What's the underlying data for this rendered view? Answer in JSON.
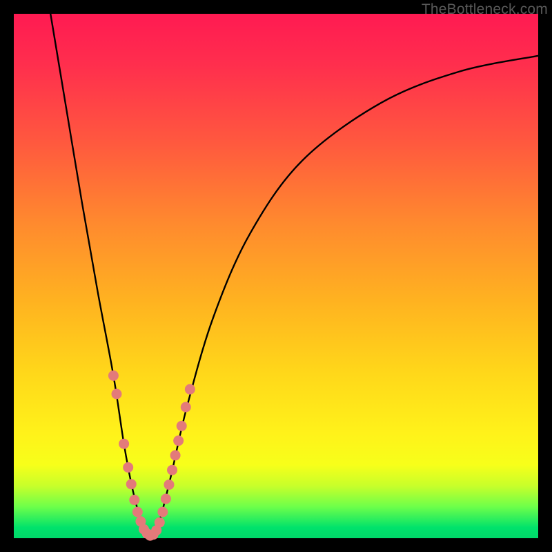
{
  "watermark": "TheBottleneck.com",
  "chart_data": {
    "type": "line",
    "title": "",
    "xlabel": "",
    "ylabel": "",
    "xlim": [
      0,
      100
    ],
    "ylim": [
      0,
      100
    ],
    "series": [
      {
        "name": "bottleneck-curve",
        "x": [
          7,
          10,
          13,
          16,
          19,
          21,
          22.5,
          24,
          25,
          26,
          27,
          28,
          30,
          33,
          38,
          45,
          55,
          70,
          85,
          100
        ],
        "y": [
          100,
          82,
          64,
          47,
          31,
          18,
          10,
          4,
          0.8,
          0.5,
          1.2,
          4,
          12,
          25,
          42,
          58,
          72,
          83,
          89,
          92
        ]
      }
    ],
    "markers": {
      "name": "highlight-points",
      "color": "#e37a7a",
      "x": [
        19.0,
        19.6,
        21.0,
        21.8,
        22.4,
        23.0,
        23.6,
        24.2,
        24.8,
        25.4,
        26.0,
        26.6,
        27.2,
        27.8,
        28.4,
        29.0,
        29.6,
        30.2,
        30.8,
        31.4,
        32.0,
        32.8,
        33.6
      ],
      "y": [
        31.0,
        27.5,
        18.0,
        13.5,
        10.3,
        7.3,
        5.0,
        3.2,
        1.7,
        0.9,
        0.5,
        0.7,
        1.5,
        3.0,
        5.0,
        7.5,
        10.2,
        13.0,
        15.8,
        18.6,
        21.4,
        25.0,
        28.4
      ]
    }
  }
}
